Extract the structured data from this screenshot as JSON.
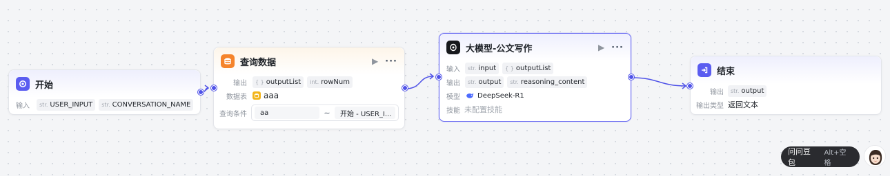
{
  "start_node": {
    "title": "开始",
    "input_label": "输入",
    "inputs": [
      {
        "type": "str.",
        "name": "USER_INPUT"
      },
      {
        "type": "str.",
        "name": "CONVERSATION_NAME"
      }
    ]
  },
  "query_node": {
    "title": "查询数据",
    "output_label": "输出",
    "outputs": [
      {
        "type": "{ }",
        "name": "outputList"
      },
      {
        "type": "int.",
        "name": "rowNum"
      }
    ],
    "table_label": "数据表",
    "table_value": "aaa",
    "condition_label": "查询条件",
    "condition_left": "aa",
    "condition_op": "∼",
    "condition_right": "开始  -  USER_I..."
  },
  "llm_node": {
    "title": "大模型-公文写作",
    "input_label": "输入",
    "inputs": [
      {
        "type": "str.",
        "name": "input"
      },
      {
        "type": "{ }",
        "name": "outputList"
      }
    ],
    "output_label": "输出",
    "outputs": [
      {
        "type": "str.",
        "name": "output"
      },
      {
        "type": "str.",
        "name": "reasoning_content"
      }
    ],
    "model_label": "模型",
    "model_value": "DeepSeek-R1",
    "skill_label": "技能",
    "skill_value": "未配置技能"
  },
  "end_node": {
    "title": "结束",
    "output_label": "输出",
    "outputs": [
      {
        "type": "str.",
        "name": "output"
      }
    ],
    "output_type_label": "输出类型",
    "output_type_value": "返回文本"
  },
  "assistant": {
    "label": "问问豆包",
    "shortcut": "Alt+空格"
  },
  "colors": {
    "accent": "#4f52e8",
    "start_icon": "#5a5cf0",
    "query_icon": "#f5842b",
    "llm_icon": "#16181c",
    "db_icon": "#f2b51c"
  }
}
